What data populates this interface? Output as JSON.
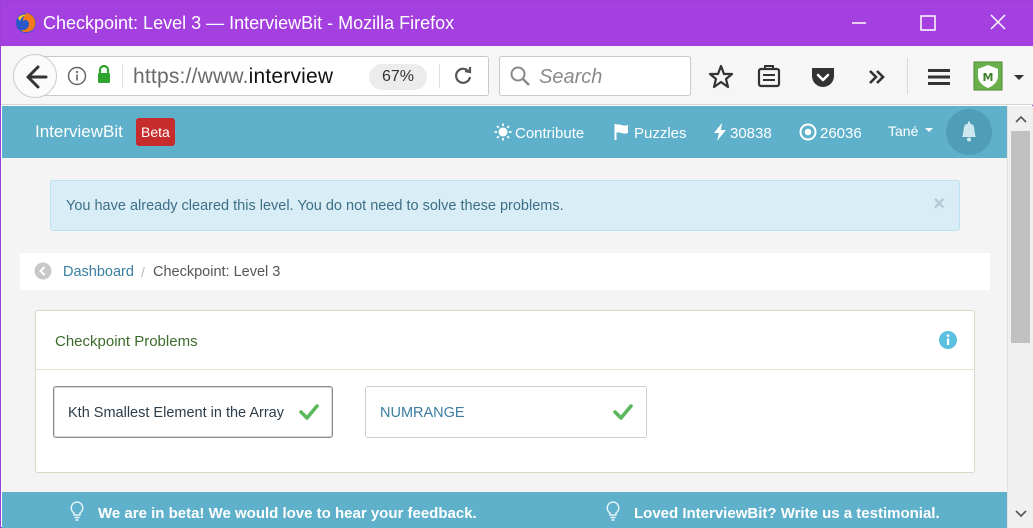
{
  "window": {
    "title": "Checkpoint: Level 3 — InterviewBit - Mozilla Firefox"
  },
  "toolbar": {
    "url_prefix": "https://www.",
    "url_domain": "interview",
    "zoom": "67%",
    "search_placeholder": "Search"
  },
  "navbar": {
    "brand": "InterviewBit",
    "badge": "Beta",
    "contribute": "Contribute",
    "puzzles": "Puzzles",
    "score": "30838",
    "coins": "26036",
    "user": "Tané"
  },
  "alert": {
    "message": "You have already cleared this level. You do not need to solve these problems.",
    "close": "×"
  },
  "breadcrumb": {
    "dashboard": "Dashboard",
    "separator": "/",
    "current": "Checkpoint: Level 3"
  },
  "panel": {
    "title": "Checkpoint Problems",
    "problems": [
      {
        "label": "Kth Smallest Element in the Array",
        "solved": true
      },
      {
        "label": "NUMRANGE",
        "solved": true
      }
    ]
  },
  "footer": {
    "feedback": "We are in beta! We would love to hear your feedback.",
    "testimonial": "Loved InterviewBit? Write us a testimonial."
  },
  "colors": {
    "titlebar": "#a43fe0",
    "navbar": "#5eb0cb",
    "beta_badge": "#c62c2c",
    "check": "#5cb85c"
  }
}
